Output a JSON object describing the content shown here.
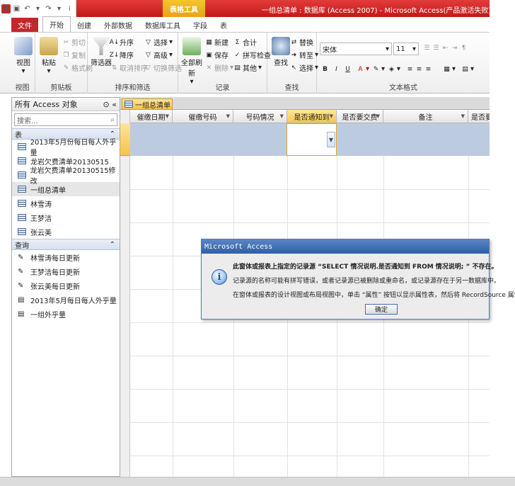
{
  "window": {
    "title": "一组总清单 : 数据库 (Access 2007) - Microsoft Access(产品激活失败)",
    "context_tab": "表格工具"
  },
  "ribbon_tabs": [
    "文件",
    "开始",
    "创建",
    "外部数据",
    "数据库工具",
    "字段",
    "表"
  ],
  "ribbon": {
    "views": {
      "view": "视图",
      "group": "视图"
    },
    "clipboard": {
      "paste": "粘贴",
      "cut": "剪切",
      "copy": "复制",
      "format_painter": "格式刷",
      "group": "剪贴板"
    },
    "sort_filter": {
      "filter": "筛选器",
      "ascending": "升序",
      "descending": "降序",
      "remove_sort": "取消排序",
      "selection": "选择",
      "advanced": "高级",
      "toggle_filter": "切换筛选",
      "group": "排序和筛选"
    },
    "records": {
      "refresh_all": "全部刷新",
      "new": "新建",
      "save": "保存",
      "delete": "删除",
      "totals": "合计",
      "spelling": "拼写检查",
      "more": "其他",
      "group": "记录"
    },
    "find": {
      "find": "查找",
      "replace": "替换",
      "goto": "转至",
      "select": "选择",
      "group": "查找"
    },
    "text_format": {
      "font": "宋体",
      "size": "11",
      "group": "文本格式"
    }
  },
  "nav": {
    "header": "所有 Access 对象",
    "search_placeholder": "搜索...",
    "tables_label": "表",
    "tables": [
      "2013年5月份每日每人外乎量",
      "龙岩欠费清单20130515",
      "龙岩欠费清单20130515修改",
      "一组总清单",
      "林雪涛",
      "王梦洁",
      "张云美"
    ],
    "queries_label": "查询",
    "queries": [
      "林雪涛每日更新",
      "王梦洁每日更新",
      "张云美每日更新",
      "2013年5月每日每人外乎量",
      "一组外乎量"
    ]
  },
  "document": {
    "tab_label": "一组总清单",
    "columns": [
      "催缴日期",
      "催缴号码",
      "号码情况",
      "是否通知到",
      "是否要交费",
      "备注",
      "是否要"
    ]
  },
  "dialog": {
    "title": "Microsoft Access",
    "line1": "此窗体或报表上指定的记录源 “SELECT 情况说明.是否通知到 FROM 情况说明; ” 不存在。",
    "line2": "记录源的名称可能有拼写错误，或者记录源已被删除或重命名，或记录源存在于另一数据库中。",
    "line3": "在窗体或报表的设计视图或布局视图中，单击 “属性” 按钮以显示属性表，然后将 RecordSource 属性设置",
    "ok": "确定"
  }
}
